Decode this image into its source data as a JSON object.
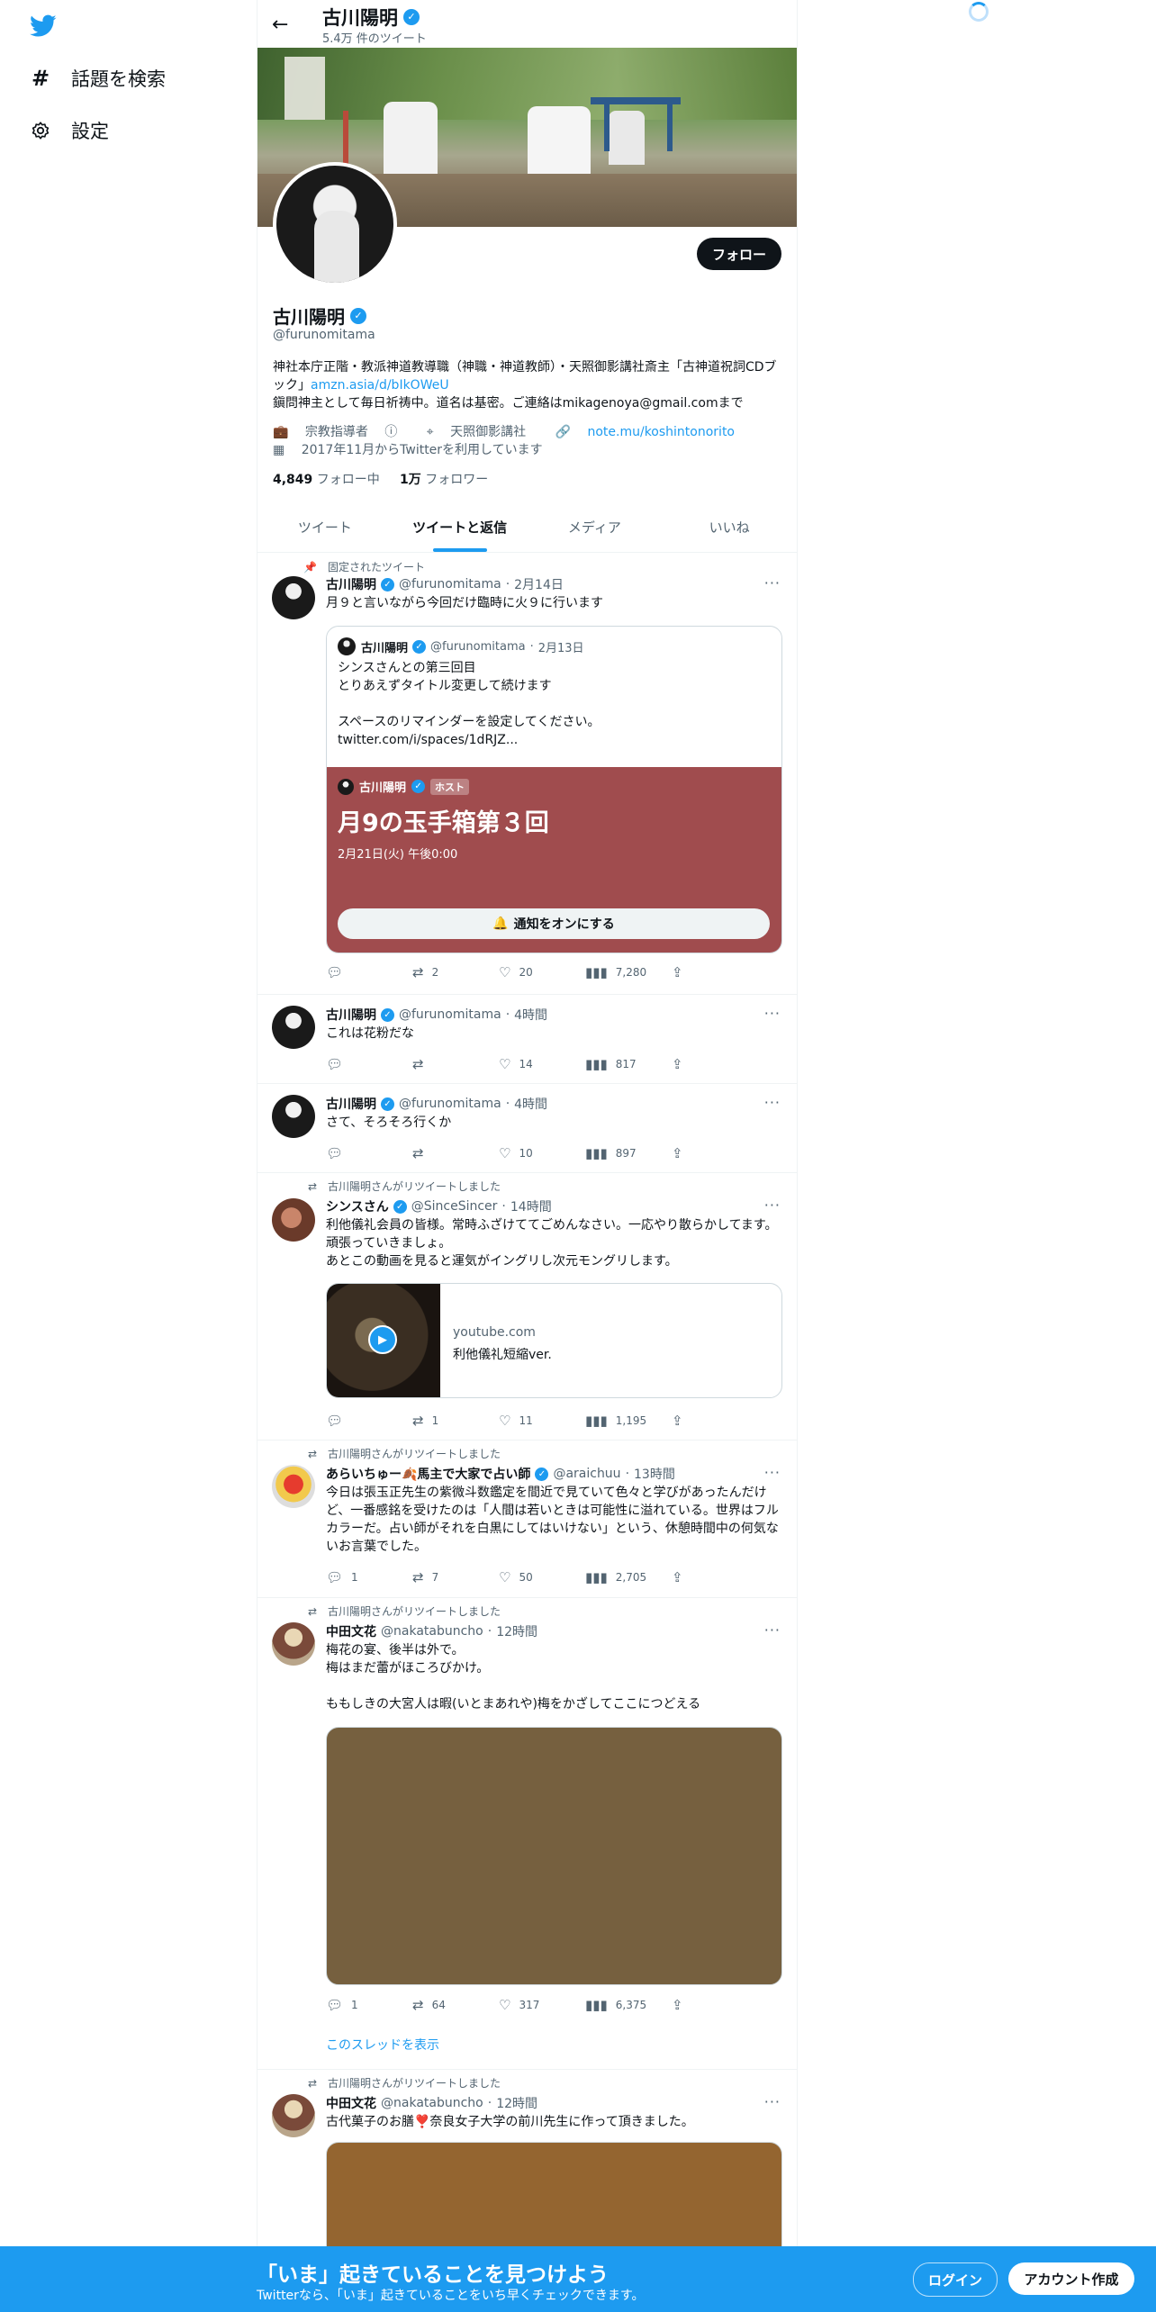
{
  "sidebar": {
    "items": [
      {
        "label": "話題を検索",
        "icon": "hashtag-icon"
      },
      {
        "label": "設定",
        "icon": "gear-icon"
      }
    ]
  },
  "header": {
    "name": "古川陽明",
    "tweet_count": "5.4万 件のツイート"
  },
  "profile": {
    "name": "古川陽明",
    "handle": "@furunomitama",
    "follow_label": "フォロー",
    "bio_line1": "神社本庁正階・教派神道教導職（神職・神道教師）・天照御影講社斎主「古神道祝詞CDブック」",
    "bio_link": "amzn.asia/d/bIkOWeU",
    "bio_line2": "鎭問神主として毎日祈祷中。道名は基密。ご連絡はmikagenoya@gmail.comまで",
    "category": "宗教指導者",
    "location": "天照御影講社",
    "website": "note.mu/koshintonorito",
    "joined": "2017年11月からTwitterを利用しています",
    "following_count": "4,849",
    "following_label": "フォロー中",
    "followers_count": "1万",
    "followers_label": "フォロワー"
  },
  "tabs": [
    "ツイート",
    "ツイートと返信",
    "メディア",
    "いいね"
  ],
  "tweets": [
    {
      "context": "固定されたツイート",
      "name": "古川陽明",
      "handle": "@furunomitama",
      "time": "2月14日",
      "text": "月９と言いながら今回だけ臨時に火９に行います",
      "quote": {
        "name": "古川陽明",
        "handle": "@furunomitama",
        "time": "2月13日",
        "text": "シンスさんとの第三回目\nとりあえずタイトル変更して続けます\n\nスペースのリマインダーを設定してください。\ntwitter.com/i/spaces/1dRJZ...",
        "space_host_name": "古川陽明",
        "space_host_tag": "ホスト",
        "space_title": "月9の玉手箱第３回",
        "space_date": "2月21日(火) 午後0:00",
        "notify_label": "通知をオンにする"
      },
      "replies": "",
      "retweets": "2",
      "likes": "20",
      "views": "7,280"
    },
    {
      "name": "古川陽明",
      "handle": "@furunomitama",
      "time": "4時間",
      "text": "これは花粉だな",
      "replies": "",
      "retweets": "",
      "likes": "14",
      "views": "817"
    },
    {
      "name": "古川陽明",
      "handle": "@furunomitama",
      "time": "4時間",
      "text": "さて、そろそろ行くか",
      "replies": "",
      "retweets": "",
      "likes": "10",
      "views": "897"
    },
    {
      "context": "古川陽明さんがリツイートしました",
      "name": "シンスさん",
      "handle": "@SinceSincer",
      "time": "14時間",
      "text": "利他儀礼会員の皆様。常時ふざけててごめんなさい。一応やり散らかしてます。頑張っていきましょ。\nあとこの動画を見ると運気がイングリし次元モングリします。",
      "link_domain": "youtube.com",
      "link_title": "利他儀礼短縮ver.",
      "replies": "",
      "retweets": "1",
      "likes": "11",
      "views": "1,195"
    },
    {
      "context": "古川陽明さんがリツイートしました",
      "name": "あらいちゅー🍂馬主で大家で占い師",
      "handle": "@araichuu",
      "time": "13時間",
      "text": "今日は張玉正先生の紫微斗数鑑定を間近で見ていて色々と学びがあったんだけど、一番感銘を受けたのは「人間は若いときは可能性に溢れている。世界はフルカラーだ。占い師がそれを白黒にしてはいけない」という、休憩時間中の何気ないお言葉でした。",
      "replies": "1",
      "retweets": "7",
      "likes": "50",
      "views": "2,705"
    },
    {
      "context": "古川陽明さんがリツイートしました",
      "name": "中田文花",
      "handle": "@nakatabuncho",
      "time": "12時間",
      "text": "梅花の宴、後半は外で。\n梅はまだ蕾がほころびかけ。\n\nももしきの大宮人は暇(いとまあれや)梅をかざしてここにつどえる",
      "replies": "1",
      "retweets": "64",
      "likes": "317",
      "views": "6,375",
      "thread_link": "このスレッドを表示"
    },
    {
      "context": "古川陽明さんがリツイートしました",
      "name": "中田文花",
      "handle": "@nakatabuncho",
      "time": "12時間",
      "text": "古代菓子のお膳❣️奈良女子大学の前川先生に作って頂きました。"
    }
  ],
  "bottom_bar": {
    "title": "「いま」起きていることを見つけよう",
    "subtitle": "Twitterなら、「いま」起きていることをいち早くチェックできます。",
    "login_label": "ログイン",
    "signup_label": "アカウント作成"
  },
  "colors": {
    "accent": "#1d9bf0",
    "space_card": "#a04c4e",
    "media1": "#76603f",
    "media2": "#946530"
  }
}
